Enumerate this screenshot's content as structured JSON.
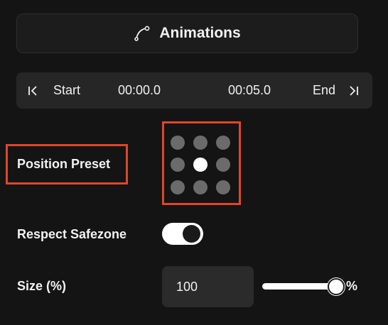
{
  "animations_button": {
    "label": "Animations",
    "icon": "curve-path-icon"
  },
  "timeline": {
    "start_label": "Start",
    "start_time": "00:00.0",
    "end_time": "00:05.0",
    "end_label": "End",
    "start_icon": "skip-to-start-icon",
    "end_icon": "skip-to-end-icon"
  },
  "position_preset": {
    "label": "Position Preset",
    "selected_index": 4,
    "options_count": 9
  },
  "safezone": {
    "label": "Respect Safezone",
    "enabled": true
  },
  "size": {
    "label": "Size (%)",
    "value": "100",
    "slider_fraction": 1.0,
    "unit": "%"
  },
  "colors": {
    "background": "#141414",
    "highlight": "#e0452b",
    "active": "#ffffff",
    "inactive_dot": "#6b6b6b"
  }
}
